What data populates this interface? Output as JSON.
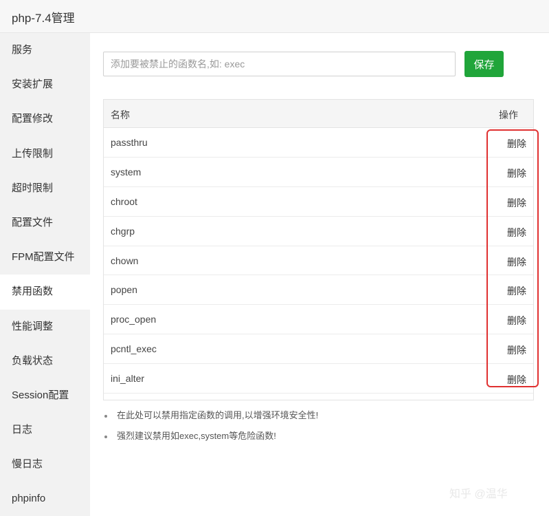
{
  "window": {
    "title": "php-7.4管理"
  },
  "sidebar": {
    "items": [
      {
        "label": "服务"
      },
      {
        "label": "安装扩展"
      },
      {
        "label": "配置修改"
      },
      {
        "label": "上传限制"
      },
      {
        "label": "超时限制"
      },
      {
        "label": "配置文件"
      },
      {
        "label": "FPM配置文件"
      },
      {
        "label": "禁用函数"
      },
      {
        "label": "性能调整"
      },
      {
        "label": "负载状态"
      },
      {
        "label": "Session配置"
      },
      {
        "label": "日志"
      },
      {
        "label": "慢日志"
      },
      {
        "label": "phpinfo"
      }
    ],
    "active": "禁用函数"
  },
  "form": {
    "input_placeholder": "添加要被禁止的函数名,如: exec",
    "input_value": "",
    "save_label": "保存"
  },
  "table": {
    "headers": {
      "name": "名称",
      "action": "操作"
    },
    "rows": [
      {
        "name": "passthru",
        "action": "删除"
      },
      {
        "name": "system",
        "action": "删除"
      },
      {
        "name": "chroot",
        "action": "删除"
      },
      {
        "name": "chgrp",
        "action": "删除"
      },
      {
        "name": "chown",
        "action": "删除"
      },
      {
        "name": "popen",
        "action": "删除"
      },
      {
        "name": "proc_open",
        "action": "删除"
      },
      {
        "name": "pcntl_exec",
        "action": "删除"
      },
      {
        "name": "ini_alter",
        "action": "删除"
      }
    ]
  },
  "notes": [
    {
      "text": "在此处可以禁用指定函数的调用,以增强环境安全性!"
    },
    {
      "text": "强烈建议禁用如exec,system等危险函数!"
    }
  ],
  "watermark": {
    "text": "知乎 @温华"
  },
  "colors": {
    "accent": "#20a53a",
    "highlight": "#e03030",
    "sidebar_bg": "#f2f2f2"
  }
}
